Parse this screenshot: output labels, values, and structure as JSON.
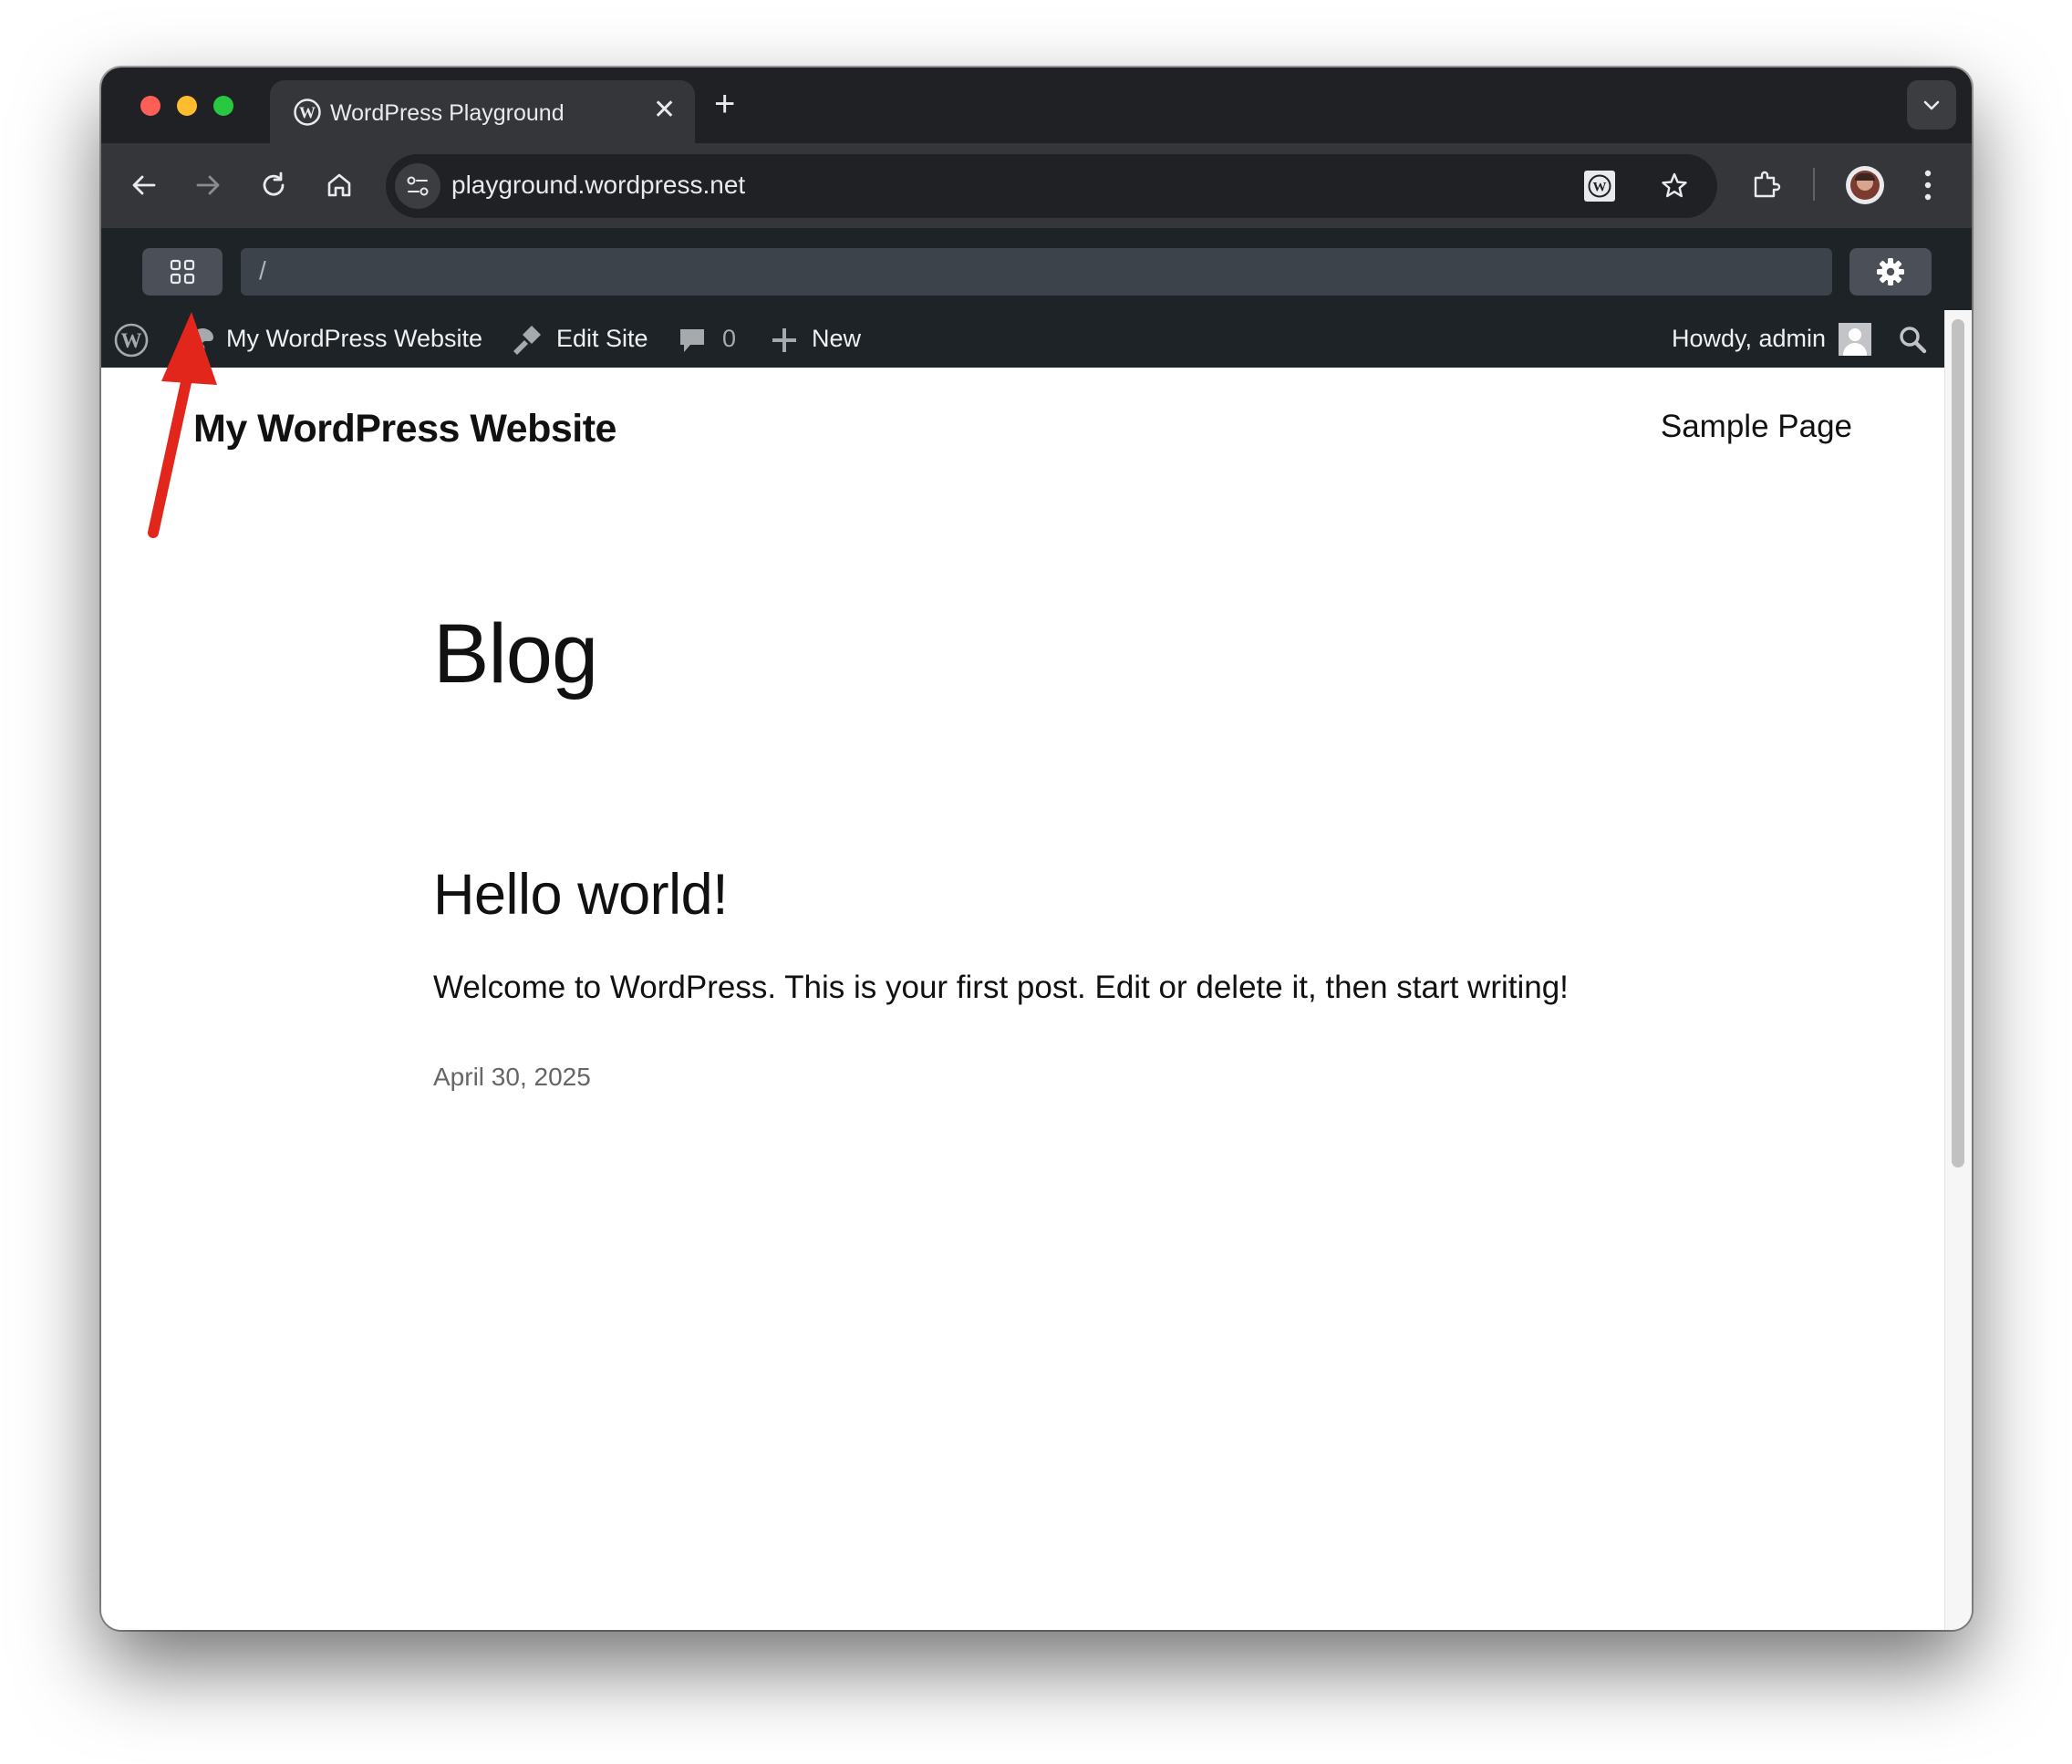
{
  "browser": {
    "tab_title": "WordPress Playground",
    "new_tab_symbol": "+",
    "close_symbol": "✕",
    "url": "playground.wordpress.net"
  },
  "playground": {
    "path": "/"
  },
  "admin_bar": {
    "site_name": "My WordPress Website",
    "edit_site": "Edit Site",
    "comments_count": "0",
    "new_label": "New",
    "greeting": "Howdy, admin"
  },
  "site": {
    "title": "My WordPress Website",
    "nav_link": "Sample Page"
  },
  "main": {
    "page_title": "Blog",
    "post_title": "Hello world!",
    "post_excerpt": "Welcome to WordPress. This is your first post. Edit or delete it, then start writing!",
    "post_date": "April 30, 2025"
  },
  "colors": {
    "annotation_arrow": "#e2261b",
    "admin_bar_bg": "#1d2327"
  },
  "icons": [
    "wordpress-logo-icon",
    "grid-icon",
    "gear-icon",
    "back-icon",
    "forward-icon",
    "reload-icon",
    "home-icon",
    "site-info-icon",
    "bookmark-star-icon",
    "extensions-icon",
    "kebab-menu-icon",
    "edit-site-icon",
    "comment-icon",
    "plus-icon",
    "search-icon",
    "palette-icon"
  ]
}
